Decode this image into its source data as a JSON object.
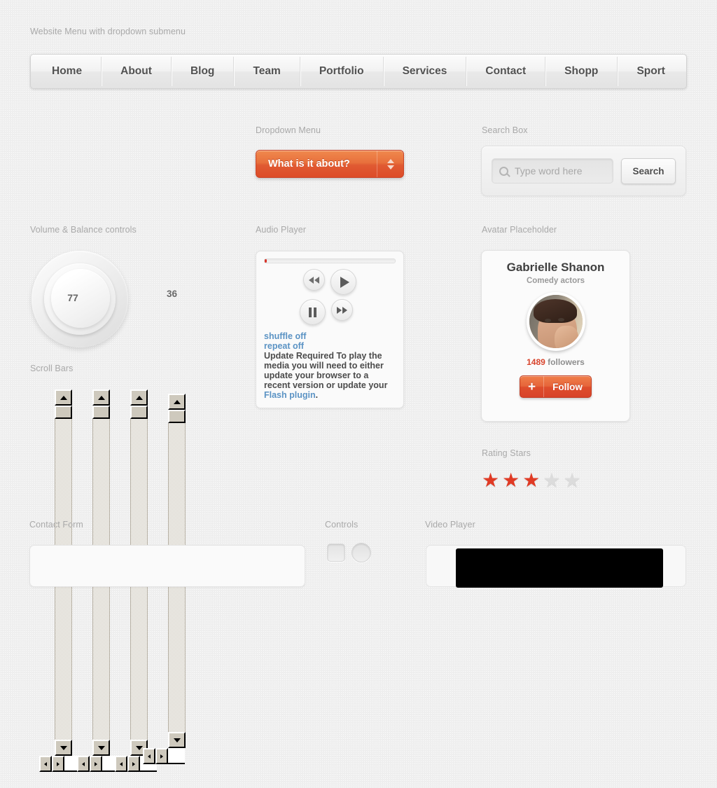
{
  "sections": {
    "menu": "Website Menu with dropdown submenu",
    "dropdown": "Dropdown Menu",
    "search": "Search Box",
    "volume": "Volume & Balance controls",
    "audio": "Audio Player",
    "avatar": "Avatar Placeholder",
    "scrollbars": "Scroll Bars",
    "rating": "Rating Stars",
    "contact": "Contact Form",
    "controls": "Controls",
    "video": "Video Player"
  },
  "menubar": {
    "items": [
      {
        "label": "Home"
      },
      {
        "label": "About"
      },
      {
        "label": "Blog"
      },
      {
        "label": "Team"
      },
      {
        "label": "Portfolio"
      },
      {
        "label": "Services"
      },
      {
        "label": "Contact"
      },
      {
        "label": "Shopp"
      },
      {
        "label": "Sport"
      }
    ]
  },
  "dropdown": {
    "selected": "What is it about?",
    "arrow_up_icon": "triangle-up-icon",
    "arrow_down_icon": "triangle-down-icon"
  },
  "search": {
    "placeholder": "Type word here",
    "value": "",
    "button_label": "Search",
    "icon": "search-icon"
  },
  "volume": {
    "knob_value": "77",
    "balance_value": "36"
  },
  "audio": {
    "progress_percent": 2,
    "buttons": {
      "rewind": "rewind-icon",
      "play": "play-icon",
      "pause": "pause-icon",
      "forward": "fast-forward-icon"
    },
    "shuffle": "shuffle off",
    "repeat": "repeat off",
    "message": "Update Required To play the media you will need to either update your browser to a recent version or update your ",
    "message_link": "Flash plugin",
    "message_end": "."
  },
  "avatar": {
    "name": "Gabrielle Shanon",
    "role": "Comedy actors",
    "followers_count": "1489",
    "followers_label": "followers",
    "follow_button": "Follow",
    "plus_icon": "plus-icon"
  },
  "scrollbars": {
    "bars": [
      {
        "up_icon": "scroll-up-arrow-icon",
        "down_icon": "scroll-down-arrow-icon"
      },
      {
        "up_icon": "scroll-up-arrow-icon",
        "down_icon": "scroll-down-arrow-icon"
      },
      {
        "up_icon": "scroll-up-arrow-icon",
        "down_icon": "scroll-down-arrow-icon"
      },
      {
        "up_icon": "scroll-up-arrow-icon",
        "down_icon": "scroll-down-arrow-icon"
      }
    ]
  },
  "rating": {
    "filled": 3,
    "total": 5,
    "filled_color": "#e03a24",
    "empty_color": "#dcdcdc",
    "glyph": "★"
  },
  "colors": {
    "background": "#efefef",
    "accent_orange": "#e0542f",
    "accent_red": "#d8342a",
    "link_blue": "#5b93c4",
    "label_gray": "#a9a9a9"
  }
}
